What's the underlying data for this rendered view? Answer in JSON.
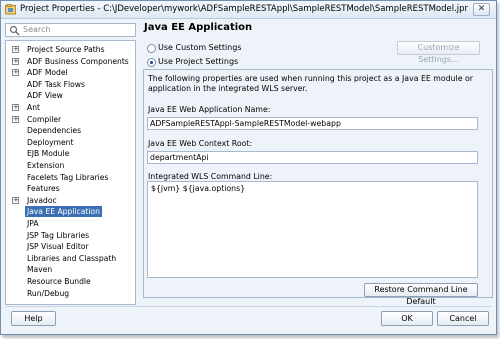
{
  "window": {
    "title": "Project Properties - C:\\JDeveloper\\mywork\\ADFSampleRESTAppl\\SampleRESTModel\\SampleRESTModel.jpr",
    "close_symbol": "✕"
  },
  "search": {
    "placeholder": "Search",
    "icon": "search-icon"
  },
  "tree": {
    "items": [
      {
        "label": "Project Source Paths",
        "expandable": true,
        "indent": 0
      },
      {
        "label": "ADF Business Components",
        "expandable": true,
        "indent": 0
      },
      {
        "label": "ADF Model",
        "expandable": true,
        "indent": 0
      },
      {
        "label": "ADF Task Flows",
        "expandable": false,
        "indent": 0
      },
      {
        "label": "ADF View",
        "expandable": false,
        "indent": 0
      },
      {
        "label": "Ant",
        "expandable": true,
        "indent": 0
      },
      {
        "label": "Compiler",
        "expandable": true,
        "indent": 0
      },
      {
        "label": "Dependencies",
        "expandable": false,
        "indent": 0
      },
      {
        "label": "Deployment",
        "expandable": false,
        "indent": 0
      },
      {
        "label": "EJB Module",
        "expandable": false,
        "indent": 0
      },
      {
        "label": "Extension",
        "expandable": false,
        "indent": 0
      },
      {
        "label": "Facelets Tag Libraries",
        "expandable": false,
        "indent": 0
      },
      {
        "label": "Features",
        "expandable": false,
        "indent": 0
      },
      {
        "label": "Javadoc",
        "expandable": true,
        "indent": 0
      },
      {
        "label": "Java EE Application",
        "expandable": false,
        "indent": 0,
        "selected": true
      },
      {
        "label": "JPA",
        "expandable": false,
        "indent": 0
      },
      {
        "label": "JSP Tag Libraries",
        "expandable": false,
        "indent": 0
      },
      {
        "label": "JSP Visual Editor",
        "expandable": false,
        "indent": 0
      },
      {
        "label": "Libraries and Classpath",
        "expandable": false,
        "indent": 0
      },
      {
        "label": "Maven",
        "expandable": false,
        "indent": 0
      },
      {
        "label": "Resource Bundle",
        "expandable": false,
        "indent": 0
      },
      {
        "label": "Run/Debug",
        "expandable": false,
        "indent": 0
      }
    ],
    "expand_symbol": "+"
  },
  "main": {
    "title": "Java EE Application",
    "use_custom_settings": "Use Custom Settings",
    "customize_settings": "Customize Settings...",
    "use_project_settings": "Use Project Settings",
    "description": "The following properties are used when running this project as a Java EE module or application in the integrated WLS server.",
    "web_app_name_label": "Java EE Web Application Name:",
    "web_app_name_value": "ADFSampleRESTAppl-SampleRESTModel-webapp",
    "context_root_label": "Java EE Web Context Root:",
    "context_root_value": "departmentApi",
    "wls_cmd_label": "Integrated WLS Command Line:",
    "wls_cmd_value": "${jvm} ${java.options}",
    "restore_button": "Restore Command Line Default",
    "selected_option": "Use Project Settings"
  },
  "footer": {
    "help": "Help",
    "ok": "OK",
    "cancel": "Cancel"
  },
  "colors": {
    "selection": "#3b6fb3",
    "window_bg": "#eef3fa",
    "border": "#a9b9cd"
  }
}
